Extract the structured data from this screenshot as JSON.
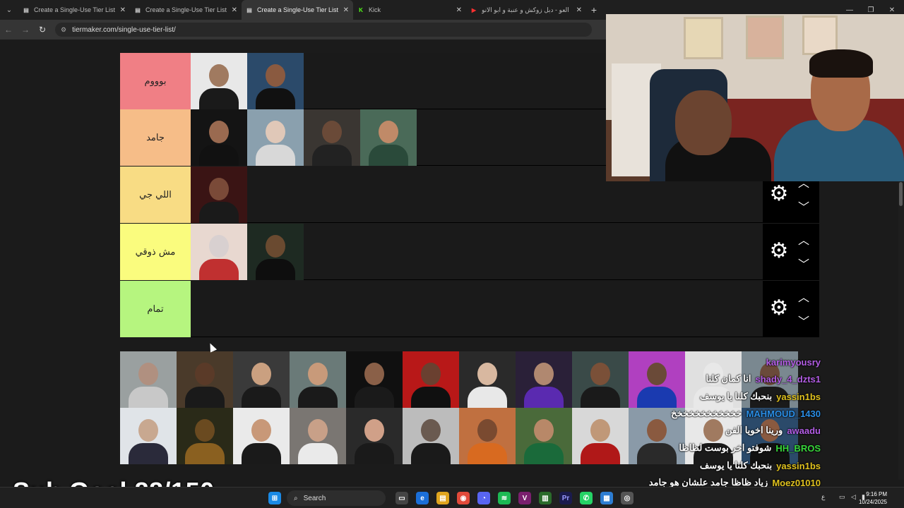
{
  "browser": {
    "tabs": [
      {
        "title": "Create a Single-Use Tier List (P",
        "active": false,
        "favicon": "tiermaker-icon"
      },
      {
        "title": "Create a Single-Use Tier List (P",
        "active": false,
        "favicon": "tiermaker-icon"
      },
      {
        "title": "Create a Single-Use Tier List (P",
        "active": true,
        "favicon": "tiermaker-icon"
      },
      {
        "title": "Kick",
        "active": false,
        "favicon": "kick-icon"
      },
      {
        "title": "العو - دبل زوكش و عنبة و ابو الانو",
        "active": false,
        "favicon": "youtube-icon"
      }
    ],
    "url": "tiermaker.com/single-use-tier-list/",
    "new_tab": "+"
  },
  "tiers": [
    {
      "label": "بوووم",
      "color": "#f07f85",
      "items": 2
    },
    {
      "label": "جامد",
      "color": "#f6bd88",
      "items": 4
    },
    {
      "label": "اللي جي",
      "color": "#f8dc84",
      "items": 1
    },
    {
      "label": "مش ذوقي",
      "color": "#fafc7e",
      "items": 2
    },
    {
      "label": "تمام",
      "color": "#b6f57f",
      "items": 0
    }
  ],
  "pool": {
    "count": 24
  },
  "chat": [
    {
      "user": "karimyousry",
      "color": "#b45ee6",
      "message": ""
    },
    {
      "user": "shady_4_dzts1",
      "color": "#b45ee6",
      "message": "انا كمان كلنا"
    },
    {
      "user": "yassin1bs",
      "color": "#e0c21e",
      "message": "بنحبك كلنا يا يوسف"
    },
    {
      "user": "MAHMOUD_1430",
      "color": "#2a8ee6",
      "message": "خخخخخخخخخخخخ"
    },
    {
      "user": "awaadu",
      "color": "#b45ee6",
      "message": "ورينا اخويا الفن"
    },
    {
      "user": "HH_BROS",
      "color": "#37d63a",
      "message": "شوفتو اخر بوست لظاظا"
    },
    {
      "user": "yassin1bs",
      "color": "#e0c21e",
      "message": "بنحبك كلنا يا يوسف"
    },
    {
      "user": "Moez01010",
      "color": "#e0c21e",
      "message": "زياد ظاظا جامد علشان هو جامد"
    },
    {
      "user": "awaadu",
      "color": "#b45ee6",
      "message": "ورينا اخويا الفن"
    }
  ],
  "sub_goal": "Sub Goal 88/150",
  "taskbar": {
    "search_label": "Search",
    "time": "9:16 PM",
    "date": "10/24/2025",
    "lang": "ع"
  }
}
